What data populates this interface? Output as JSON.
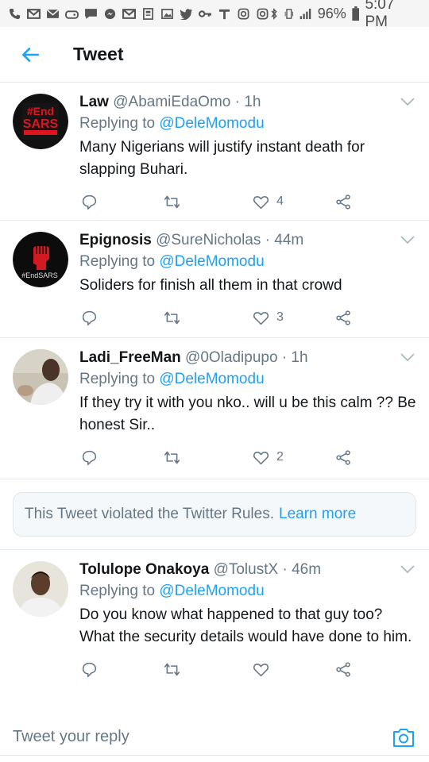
{
  "status_bar": {
    "battery": "96%",
    "time": "5:07 PM",
    "icons": [
      "phone-icon",
      "mail-icon",
      "mail-icon",
      "game-icon",
      "chat-icon",
      "messenger-icon",
      "mail-icon",
      "news-icon",
      "photo-icon",
      "twitter-icon",
      "key-icon",
      "t-icon",
      "instagram-icon",
      "instagram-icon",
      "bluetooth-icon",
      "vibrate-icon",
      "signal-icon",
      "battery-icon"
    ]
  },
  "header": {
    "title": "Tweet",
    "back_icon": "arrow-left-icon"
  },
  "colors": {
    "accent": "#1da1f2",
    "secondary_text": "#657786",
    "divider": "#e1e8ed"
  },
  "tweets": [
    {
      "name": "Law",
      "handle": "@AbamiEdaOmo",
      "dot": "·",
      "time": "1h",
      "replying_prefix": "Replying to",
      "replying_to": "@DeleMomodu",
      "text": "Many Nigerians will justify instant death for slapping Buhari.",
      "likes": "4",
      "avatar": "endsars-logo"
    },
    {
      "name": "Epignosis",
      "handle": "@SureNicholas",
      "dot": "·",
      "time": "44m",
      "replying_prefix": "Replying to",
      "replying_to": "@DeleMomodu",
      "text": "Soliders for finish all them in that crowd",
      "likes": "3",
      "avatar": "endsars-fist"
    },
    {
      "name": "Ladi_FreeMan",
      "handle": "@0Oladipupo",
      "dot": "·",
      "time": "1h",
      "replying_prefix": "Replying to",
      "replying_to": "@DeleMomodu",
      "text": "If they try it with you nko.. will u be this calm ?? Be honest Sir..",
      "likes": "2",
      "avatar": "photo"
    },
    {
      "name": "Tolulope Onakoya",
      "handle": "@TolustX",
      "dot": "·",
      "time": "46m",
      "replying_prefix": "Replying to",
      "replying_to": "@DeleMomodu",
      "text": "Do you know what happened to that guy too? What the security details would have done to him.",
      "likes": "",
      "avatar": "photo"
    }
  ],
  "violation": {
    "text": "This Tweet violated the Twitter Rules.",
    "link": "Learn more"
  },
  "reply_bar": {
    "placeholder": "Tweet your reply",
    "camera_icon": "camera-icon"
  }
}
